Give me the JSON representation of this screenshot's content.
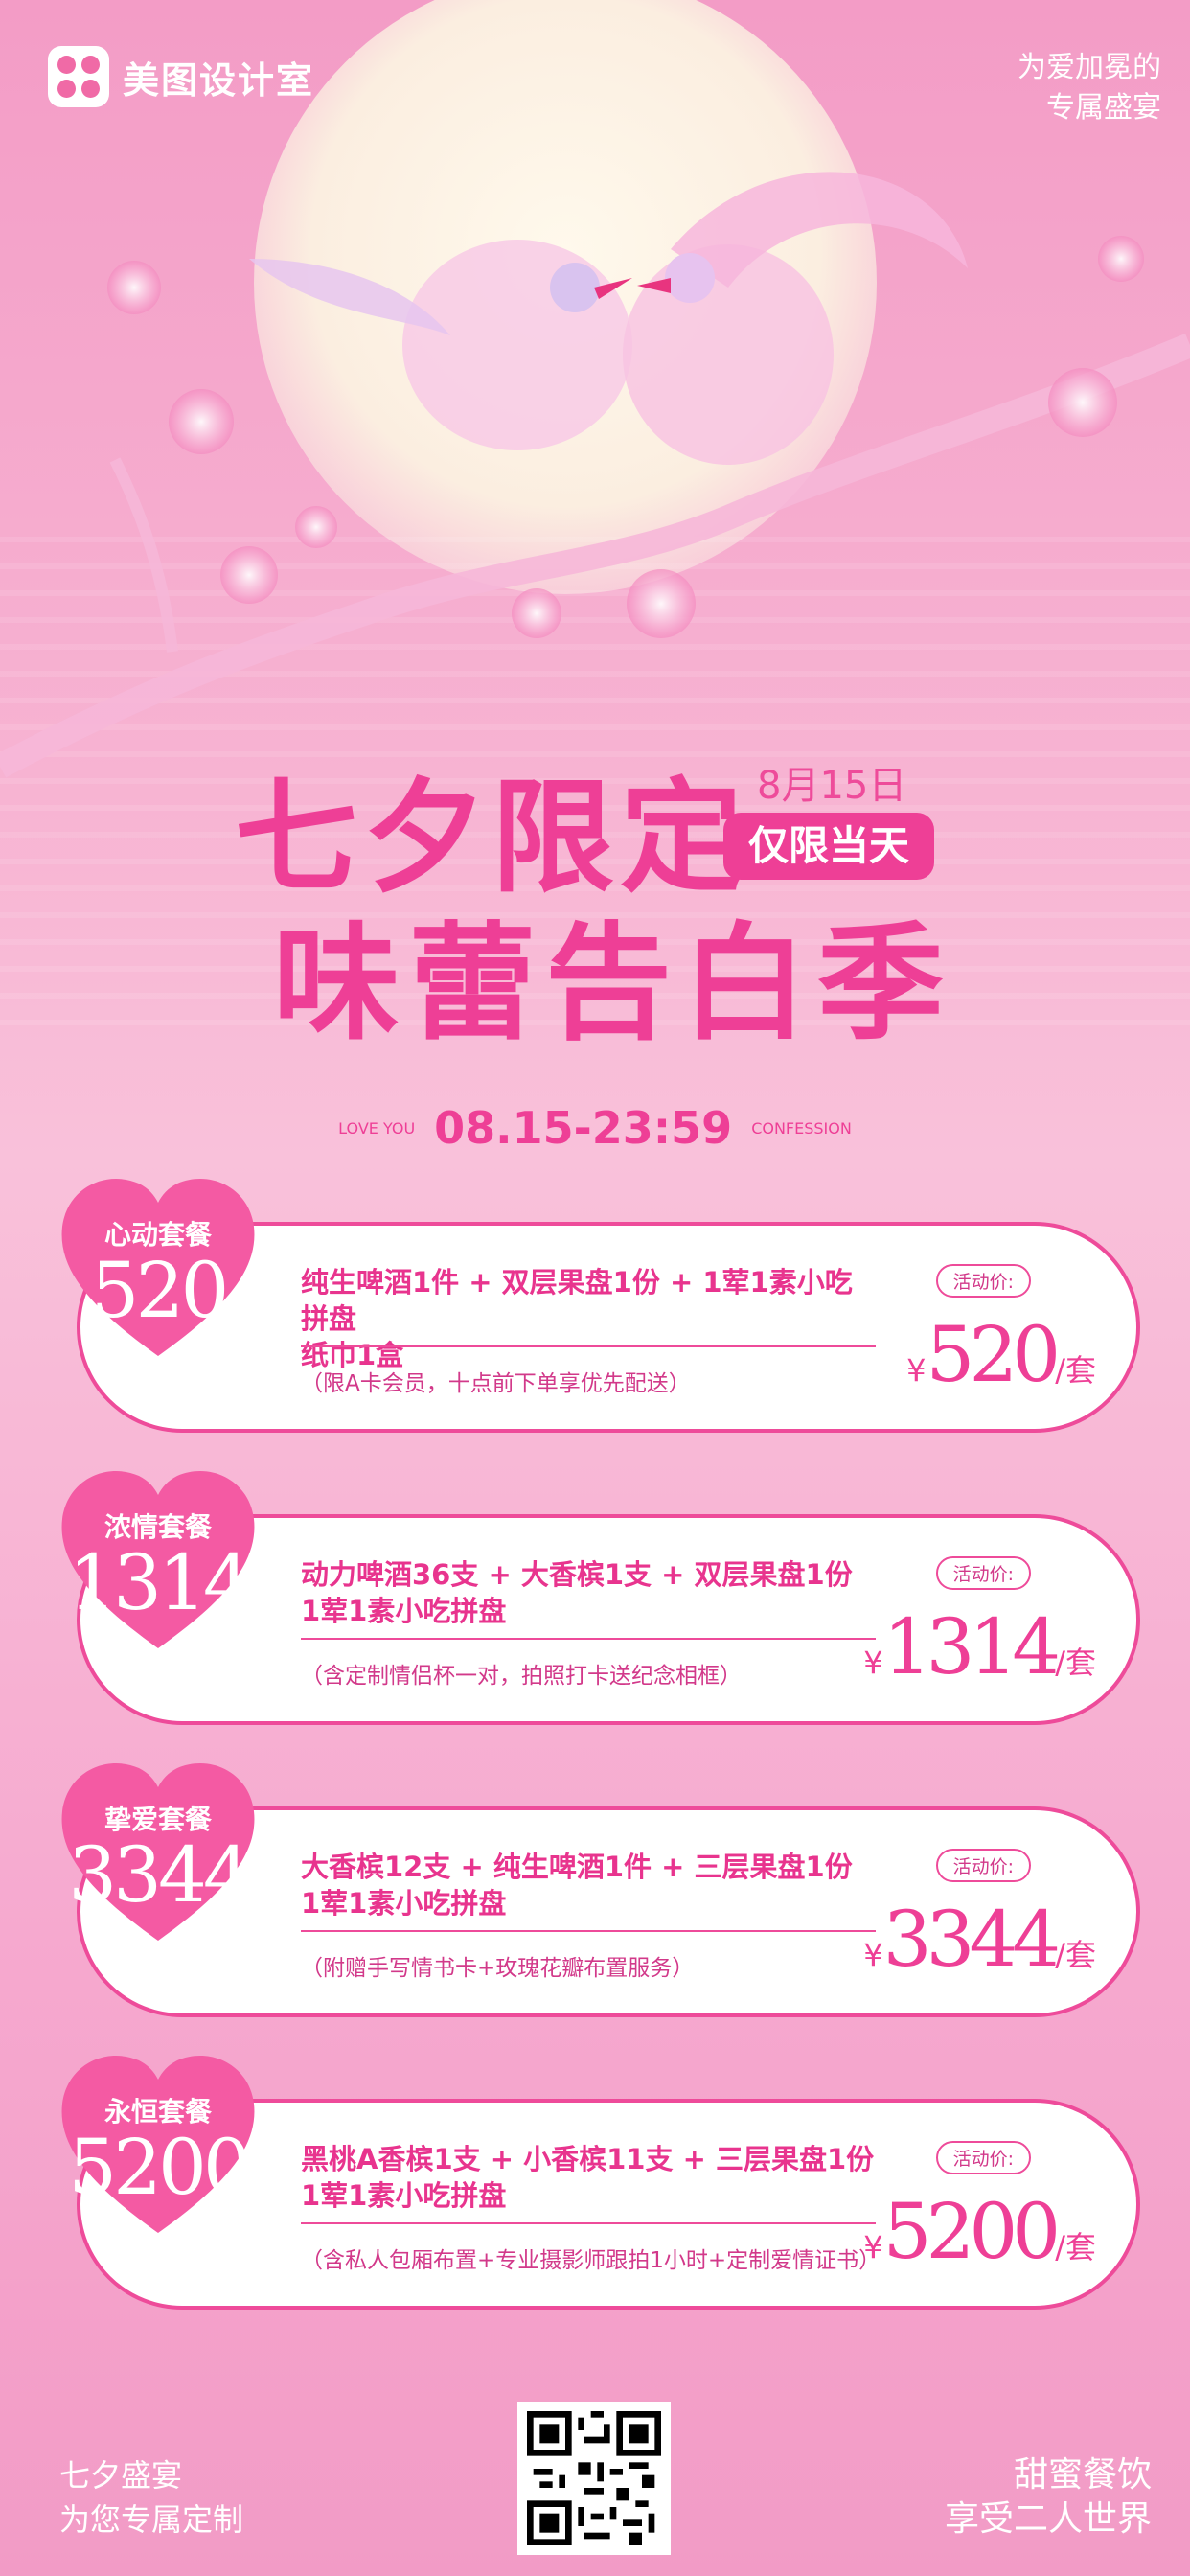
{
  "brand": {
    "name": "美图设计室"
  },
  "header": {
    "right_line1": "为爱加冕的",
    "right_line2": "专属盛宴"
  },
  "titles": {
    "line1": "七夕限定",
    "line2": "味蕾告白季",
    "date": "8月15日",
    "badge": "仅限当天"
  },
  "slogan": {
    "left": "LOVE YOU",
    "center": "08.15-23:59",
    "right": "CONFESSION"
  },
  "packages": [
    {
      "name": "心动套餐",
      "num": "520",
      "line1": "纯生啤酒1件 + 双层果盘1份 + 1荤1素小吃拼盘",
      "line2": "纸巾1盒",
      "note": "（限A卡会员，十点前下单享优先配送）",
      "tag": "活动价:",
      "currency": "¥",
      "price": "520",
      "unit": "/套"
    },
    {
      "name": "浓情套餐",
      "num": "1314",
      "line1": "动力啤酒36支 + 大香槟1支 + 双层果盘1份",
      "line2": "1荤1素小吃拼盘",
      "note": "（含定制情侣杯一对，拍照打卡送纪念相框）",
      "tag": "活动价:",
      "currency": "¥",
      "price": "1314",
      "unit": "/套"
    },
    {
      "name": "挚爱套餐",
      "num": "3344",
      "line1": "大香槟12支 + 纯生啤酒1件 + 三层果盘1份",
      "line2": "1荤1素小吃拼盘",
      "note": "（附赠手写情书卡+玫瑰花瓣布置服务）",
      "tag": "活动价:",
      "currency": "¥",
      "price": "3344",
      "unit": "/套"
    },
    {
      "name": "永恒套餐",
      "num": "5200",
      "line1": "黑桃A香槟1支 + 小香槟11支 + 三层果盘1份",
      "line2": "1荤1素小吃拼盘",
      "note": "（含私人包厢布置+专业摄影师跟拍1小时+定制爱情证书）",
      "tag": "活动价:",
      "currency": "¥",
      "price": "5200",
      "unit": "/套"
    }
  ],
  "footer": {
    "left1": "七夕盛宴",
    "left2": "为您专属定制",
    "right1": "甜蜜餐饮",
    "right2": "享受二人世界"
  },
  "colors": {
    "accent": "#ee3f96",
    "background": "#f7b3d2"
  }
}
